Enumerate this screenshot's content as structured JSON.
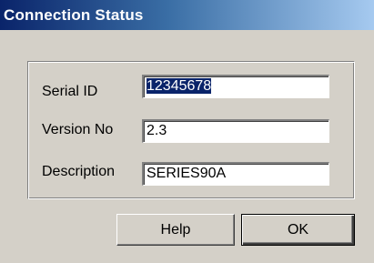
{
  "window": {
    "title": "Connection Status"
  },
  "fields": {
    "serial": {
      "label": "Serial ID",
      "value": "12345678"
    },
    "version": {
      "label": "Version No",
      "value": "2.3"
    },
    "description": {
      "label": "Description",
      "value": "SERIES90A"
    }
  },
  "buttons": {
    "help": "Help",
    "ok": "OK"
  },
  "colors": {
    "titlebar_start": "#0a246a",
    "titlebar_end": "#a6caf0",
    "dialog_face": "#d4d0c8",
    "selection": "#0a246a"
  }
}
